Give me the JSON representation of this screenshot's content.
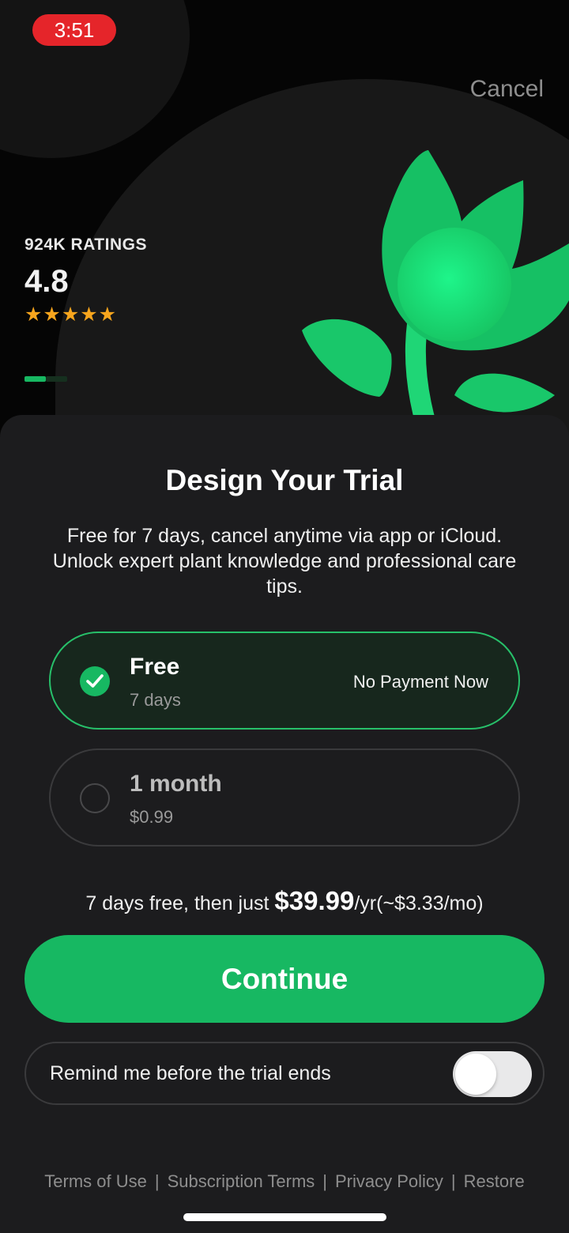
{
  "status_bar": {
    "time": "3:51"
  },
  "header": {
    "cancel_label": "Cancel"
  },
  "ratings": {
    "count_label": "924K RATINGS",
    "score": "4.8",
    "stars": "★★★★★",
    "star_count": 5
  },
  "carousel": {
    "page_count": 2,
    "active_index": 0
  },
  "sheet": {
    "title": "Design Your Trial",
    "subtitle": "Free for 7 days, cancel anytime via app or iCloud. Unlock expert plant knowledge and professional care tips."
  },
  "plans": [
    {
      "name": "Free",
      "detail": "7 days",
      "note": "No Payment Now",
      "selected": true
    },
    {
      "name": "1 month",
      "detail": "$0.99",
      "note": "",
      "selected": false
    }
  ],
  "pricing": {
    "prefix": "7 days free, then just ",
    "price": "$39.99",
    "suffix": "/yr(~$3.33/mo)"
  },
  "continue_label": "Continue",
  "reminder": {
    "label": "Remind me before the trial ends",
    "enabled": false
  },
  "footer": {
    "links": [
      "Terms of Use",
      "Subscription Terms",
      "Privacy Policy",
      "Restore"
    ]
  },
  "colors": {
    "accent": "#17b862",
    "status_red": "#e5252a",
    "star": "#f7a51d",
    "sheet_bg": "#1c1c1e"
  }
}
